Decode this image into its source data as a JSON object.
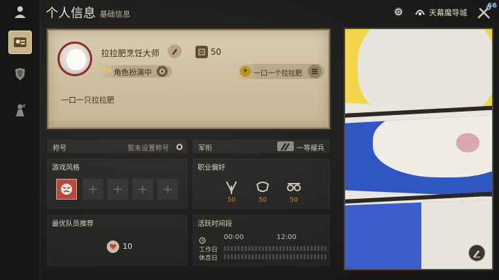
{
  "header": {
    "title": "个人信息",
    "subtitle": "基础信息",
    "location": "天幕魔导城",
    "tools_badge": "66"
  },
  "rail": {
    "items": [
      {
        "icon": "id-card-icon",
        "active": true
      },
      {
        "icon": "armor-icon",
        "active": false
      },
      {
        "icon": "character-icon",
        "active": false
      }
    ]
  },
  "profile": {
    "name": "拉拉肥烹饪大师",
    "level_value": "50",
    "rp_badge": "Rp",
    "rp_text": "角色扮演中",
    "team_text": "一口一个拉拉肥",
    "bio": "一口一只拉拉肥"
  },
  "title_row": {
    "label": "称号",
    "value": "暂未设置称号"
  },
  "rank_row": {
    "label": "军衔",
    "value": "一等耀兵"
  },
  "play_style": {
    "label": "游戏风格",
    "slot_symbol": "+"
  },
  "job_pref": {
    "label": "职业偏好",
    "values": [
      "50",
      "50",
      "50"
    ]
  },
  "best_party": {
    "label": "最优队员推荐",
    "value": "10"
  },
  "active_time": {
    "label": "活跃时间段",
    "time_start": "00:00",
    "time_mid": "12:00",
    "workday": "工作日",
    "holiday": "休息日"
  },
  "colors": {
    "accent": "#cbb48a",
    "job_value": "#d48a3a",
    "card_bg": "#d9ccb3"
  }
}
